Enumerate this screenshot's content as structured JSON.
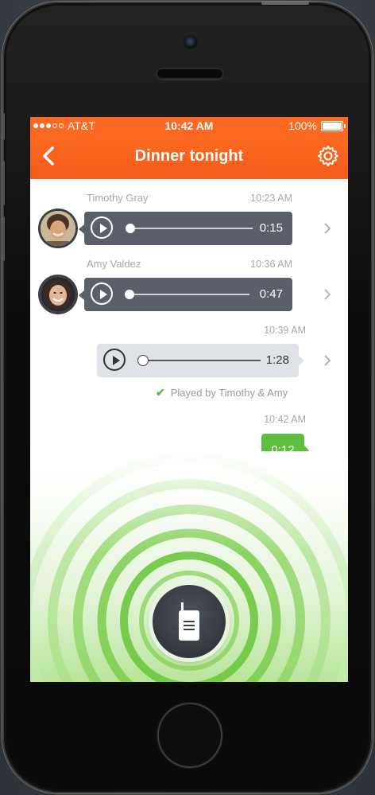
{
  "status_bar": {
    "carrier": "AT&T",
    "time": "10:42 AM",
    "battery": "100%",
    "signal_bars_filled": 3,
    "signal_bars_total": 5
  },
  "nav": {
    "title": "Dinner tonight",
    "back_icon": "chevron-left-icon",
    "settings_icon": "gear-icon"
  },
  "messages": [
    {
      "sender": "Timothy Gray",
      "time": "10:23 AM",
      "duration": "0:15",
      "direction": "incoming",
      "progress": 0
    },
    {
      "sender": "Amy Valdez",
      "time": "10:36 AM",
      "duration": "0:47",
      "direction": "incoming",
      "progress": 0
    },
    {
      "sender": "",
      "time": "10:39 AM",
      "duration": "1:28",
      "direction": "outgoing",
      "progress": 0,
      "played_status": "Played by Timothy & Amy"
    },
    {
      "sender": "",
      "time": "10:42 AM",
      "duration": "0:12",
      "direction": "recording"
    }
  ],
  "record_button": {
    "icon": "walkie-talkie-icon"
  },
  "colors": {
    "accent": "#fa6822",
    "incoming_bubble": "#5a6069",
    "outgoing_bubble": "#dfe3e8",
    "recording": "#5cc03e"
  }
}
